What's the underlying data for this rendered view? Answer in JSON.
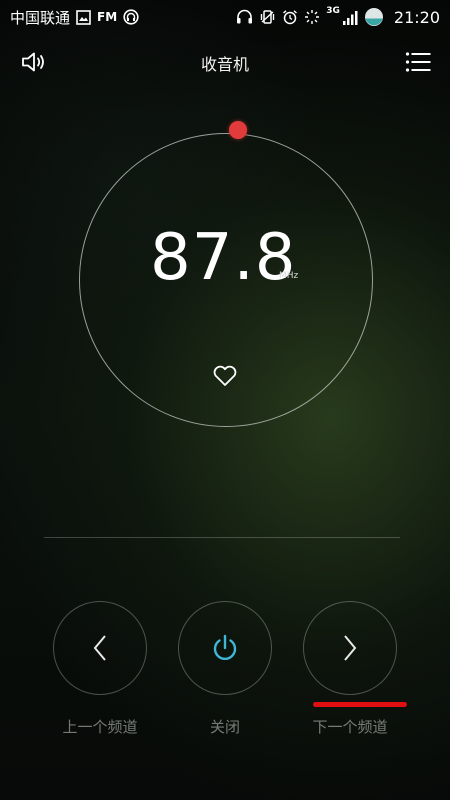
{
  "status_bar": {
    "carrier": "中国联通",
    "fm_badge": "FM",
    "network_type": "3G",
    "time": "21:20"
  },
  "header": {
    "title": "收音机"
  },
  "tuner": {
    "frequency": "87.8",
    "unit": "MHz"
  },
  "controls": {
    "prev_label": "上一个频道",
    "power_label": "关闭",
    "next_label": "下一个频道"
  },
  "colors": {
    "accent_power": "#3fb6d6",
    "knob_red": "#e23b3b",
    "annotation_red": "#e20f12"
  },
  "icons": {
    "speaker": "speaker-icon",
    "menu": "menu-icon",
    "favorite": "heart-icon",
    "prev": "chevron-left-icon",
    "power": "power-icon",
    "next": "chevron-right-icon"
  }
}
